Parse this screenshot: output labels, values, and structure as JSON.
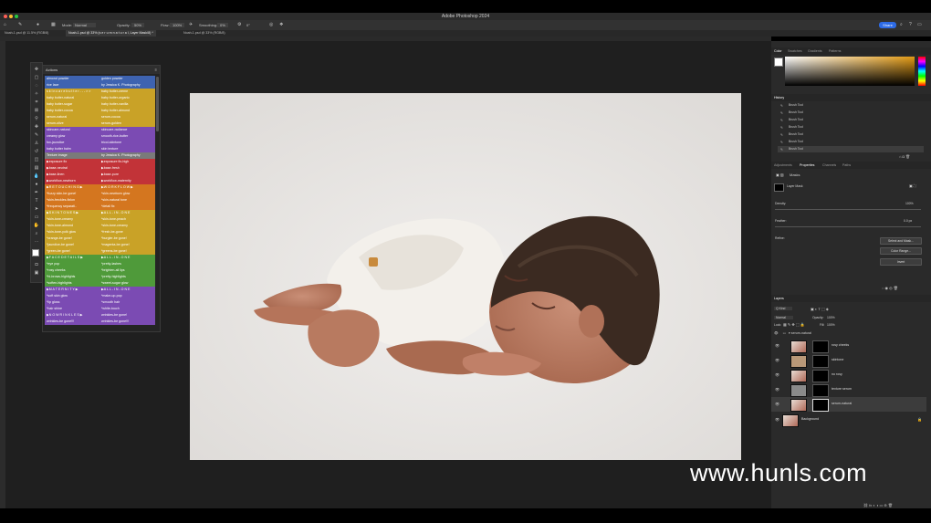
{
  "window": {
    "title": "Adobe Photoshop 2024"
  },
  "options_bar": {
    "mode_label": "Mode:",
    "mode_value": "Normal",
    "opacity_label": "Opacity:",
    "opacity_value": "50%",
    "flow_label": "Flow:",
    "flow_value": "100%",
    "smoothing_label": "Smoothing:",
    "smoothing_value": "0%",
    "angle_value": "0°",
    "share_label": "Share"
  },
  "tabs": [
    {
      "label": "Noah-1.psd @ 11.5% (RGB/8)",
      "active": false
    },
    {
      "label": "Noah-1.psd @ 33% (s e r u m  n a t u r a l, Layer Mask/8) *",
      "active": true
    },
    {
      "label": "Noah-1.psd @ 33% (RGB/8)",
      "active": false
    }
  ],
  "colors": {
    "blue": "#3e63b0",
    "gold": "#c9a227",
    "purple": "#7b4bb3",
    "gray": "#7a7a7a",
    "red": "#c23338",
    "orange": "#d4761f",
    "green": "#4f9a3a",
    "share": "#2d6be6"
  },
  "actions_panel": {
    "title": "Actions",
    "rows": [
      {
        "left": "almond powder",
        "right": "golden powder",
        "color": "blue"
      },
      {
        "left": "rice lace",
        "right": "by Jessica K. Photography",
        "color": "blue"
      },
      {
        "left": "s k i n  c a r e  b u t t e r  - - - > >",
        "right": "baby butter-creme",
        "color": "gold"
      },
      {
        "left": "baby butter-natural",
        "right": "baby butter-organic",
        "color": "gold"
      },
      {
        "left": "baby butter-sugar",
        "right": "baby butter-vanilla",
        "color": "gold"
      },
      {
        "left": "baby butter-cocoa",
        "right": "baby butter-almond",
        "color": "gold"
      },
      {
        "left": "serum-natural",
        "right": "serum-cocoa",
        "color": "gold"
      },
      {
        "left": "serum-olive",
        "right": "serum-golden",
        "color": "gold"
      },
      {
        "left": "skincare-natural",
        "right": "skincare-radiance",
        "color": "purple"
      },
      {
        "left": "creamy glow",
        "right": "smooth-rice-butter",
        "color": "purple"
      },
      {
        "left": "fox-jaundice",
        "right": "tricol-skintone",
        "color": "purple"
      },
      {
        "left": "baby butter balm",
        "right": "skin texture",
        "color": "purple"
      },
      {
        "left": "Texture image",
        "right": "by Jessica K. Photography",
        "color": "gray"
      },
      {
        "left": "▶exposure fix",
        "right": "▶exposure fix-high",
        "color": "red"
      },
      {
        "left": "▶base-neutral",
        "right": "▶base-fresh",
        "color": "red"
      },
      {
        "left": "▶base-linen",
        "right": "▶base-pure",
        "color": "red"
      },
      {
        "left": "▶workflow-newborn",
        "right": "▶workflow-maternity",
        "color": "red"
      },
      {
        "left": "▶R E T O U C H I N G ▶",
        "right": "▶W O R K F L O W ▶",
        "color": "orange"
      },
      {
        "left": "*fuzzy skin-be gone!",
        "right": "*skin-newborn glow",
        "color": "orange"
      },
      {
        "left": "*skin-freckles-fixlon",
        "right": "*skin-natural tone",
        "color": "orange"
      },
      {
        "left": "*frequency separati..",
        "right": "*detail fix",
        "color": "orange"
      },
      {
        "left": "▶S K I N  T O N E S ▶",
        "right": "▶A L L - I N - O N E",
        "color": "gold"
      },
      {
        "left": "*skin-tone-creamy",
        "right": "*skin-tone-peach",
        "color": "gold"
      },
      {
        "left": "*skin-tone-almond",
        "right": "*skin-tone-creamy",
        "color": "gold"
      },
      {
        "left": "*skin-tone-yolk glow",
        "right": "*fresh-be-gone",
        "color": "gold"
      },
      {
        "left": "*orange-be gone!",
        "right": "*burgler-be gone!",
        "color": "gold"
      },
      {
        "left": "*jaundice-be gone!",
        "right": "*magenta-be gone!",
        "color": "gold"
      },
      {
        "left": "*green-be gone!",
        "right": "*greens-be gone!",
        "color": "gold"
      },
      {
        "left": "▶F A C E  D E T A I L S ▶",
        "right": "▶A L L - I N - O N E",
        "color": "green"
      },
      {
        "left": "*eye pop",
        "right": "*pretty-lashes",
        "color": "green"
      },
      {
        "left": "*rosy cheeks",
        "right": "*brighten-all lips",
        "color": "green"
      },
      {
        "left": "*hi-brows-highlights",
        "right": "*pretty-highlights",
        "color": "green"
      },
      {
        "left": "*soften-highlights",
        "right": "*sweet-sugar glow",
        "color": "green"
      },
      {
        "left": "▶M A T E R N I T Y ▶",
        "right": "▶A L L - I N - O N E",
        "color": "purple"
      },
      {
        "left": "*soft skin glow",
        "right": "*make-up-pop",
        "color": "purple"
      },
      {
        "left": "*lip gloss",
        "right": "*smooth hair",
        "color": "purple"
      },
      {
        "left": "*hair shine",
        "right": "*white-touch",
        "color": "purple"
      },
      {
        "left": "▶N O  W R I N K L E S ▶",
        "right": "wrinkles-be gone!",
        "color": "purple"
      },
      {
        "left": "wrinkles-be gone!!!",
        "right": "wrinkles-be gone!!!",
        "color": "purple"
      }
    ]
  },
  "right_panels": {
    "color_tabs": [
      "Color",
      "Swatches",
      "Gradients",
      "Patterns"
    ],
    "history_title": "History",
    "history_items": [
      "Brush Tool",
      "Brush Tool",
      "Brush Tool",
      "Brush Tool",
      "Brush Tool",
      "Brush Tool",
      "Brush Tool"
    ],
    "properties_tabs": [
      "Adjustments",
      "Properties",
      "Channels",
      "Paths"
    ],
    "masks_label": "Masks",
    "layer_mask_label": "Layer Mask",
    "density_label": "Density:",
    "density_value": "100%",
    "feather_label": "Feather:",
    "feather_value": "0.0 px",
    "refine_label": "Refine:",
    "select_mask_button": "Select and Mask...",
    "color_range_button": "Color Range...",
    "invert_button": "Invert",
    "layers_title": "Layers",
    "kind_label": "Q Kind",
    "blend_value": "Normal",
    "opacity_label": "Opacity:",
    "opacity_value": "100%",
    "lock_label": "Lock:",
    "fill_label": "Fill:",
    "fill_value": "100%",
    "group_name": "▾ serum-natural",
    "layers": [
      "rosy cheeks",
      "skintone",
      "no rosy",
      "texture serum",
      "serum-natural"
    ],
    "background_layer": "Background"
  },
  "watermark": "www.hunls.com"
}
